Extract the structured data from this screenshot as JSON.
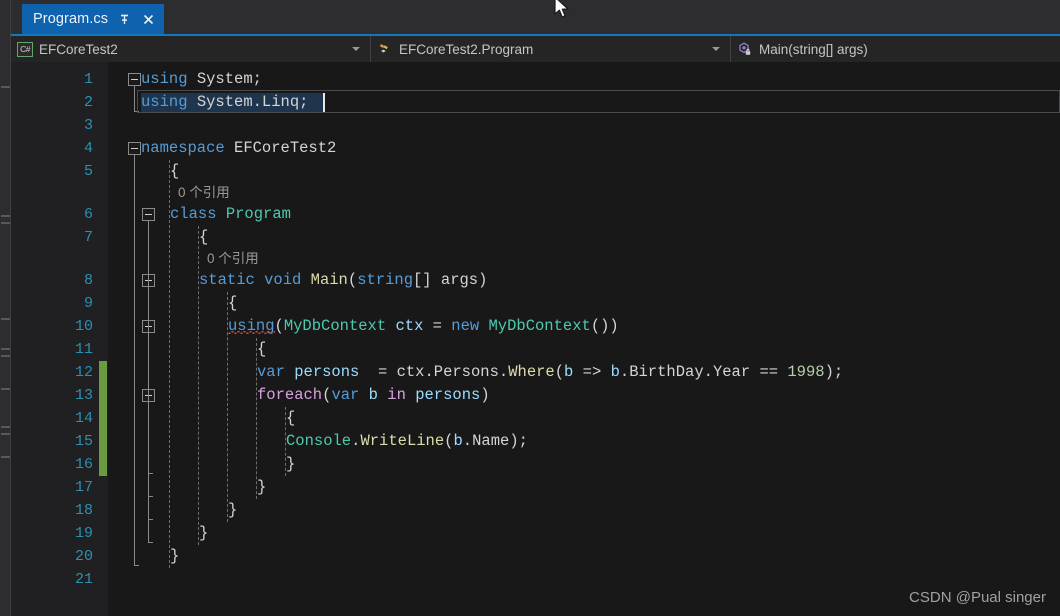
{
  "window": {
    "tab": {
      "title": "Program.cs",
      "pin_icon": "pin-icon",
      "close_icon": "close-icon"
    }
  },
  "nav_bar": {
    "project_combo": {
      "icon": "csharp-file-icon",
      "value": "EFCoreTest2",
      "dropdown_icon": "chevron-down-icon"
    },
    "type_combo": {
      "icon": "class-icon",
      "value": "EFCoreTest2.Program",
      "dropdown_icon": "chevron-down-icon"
    },
    "member_combo": {
      "icon": "method-private-icon",
      "value": "Main(string[] args)"
    }
  },
  "editor": {
    "line_numbers": [
      "1",
      "2",
      "3",
      "4",
      "5",
      "6",
      "7",
      "8",
      "9",
      "10",
      "11",
      "12",
      "13",
      "14",
      "15",
      "16",
      "17",
      "18",
      "19",
      "20",
      "21"
    ],
    "codelens": [
      {
        "text": "0 个引用",
        "for_line": "6"
      },
      {
        "text": "0 个引用",
        "for_line": "8"
      }
    ],
    "lines": [
      {
        "n": "1",
        "indent": 0,
        "tokens": [
          {
            "t": "using",
            "c": "k"
          },
          {
            "t": " System;",
            "c": "pn"
          }
        ]
      },
      {
        "n": "2",
        "indent": 0,
        "tokens": [
          {
            "t": "using",
            "c": "k"
          },
          {
            "t": " System.Linq;",
            "c": "pn"
          }
        ]
      },
      {
        "n": "3",
        "indent": 0,
        "tokens": []
      },
      {
        "n": "4",
        "indent": 0,
        "tokens": [
          {
            "t": "namespace",
            "c": "k"
          },
          {
            "t": " EFCoreTest2",
            "c": "id"
          }
        ]
      },
      {
        "n": "5",
        "indent": 1,
        "tokens": [
          {
            "t": "{",
            "c": "pn"
          }
        ]
      },
      {
        "n": "6",
        "indent": 1,
        "tokens": [
          {
            "t": "class",
            "c": "k"
          },
          {
            "t": " ",
            "c": "pn"
          },
          {
            "t": "Program",
            "c": "kc"
          }
        ]
      },
      {
        "n": "7",
        "indent": 2,
        "tokens": [
          {
            "t": "{",
            "c": "pn"
          }
        ]
      },
      {
        "n": "8",
        "indent": 2,
        "tokens": [
          {
            "t": "static",
            "c": "k"
          },
          {
            "t": " ",
            "c": "pn"
          },
          {
            "t": "void",
            "c": "k"
          },
          {
            "t": " ",
            "c": "pn"
          },
          {
            "t": "Main",
            "c": "mth"
          },
          {
            "t": "(",
            "c": "pn"
          },
          {
            "t": "string",
            "c": "k"
          },
          {
            "t": "[] ",
            "c": "pn"
          },
          {
            "t": "args",
            "c": "id"
          },
          {
            "t": ")",
            "c": "pn"
          }
        ]
      },
      {
        "n": "9",
        "indent": 3,
        "tokens": [
          {
            "t": "{",
            "c": "pn"
          }
        ]
      },
      {
        "n": "10",
        "indent": 3,
        "tokens": [
          {
            "t": "using",
            "c": "k"
          },
          {
            "t": "(",
            "c": "pn"
          },
          {
            "t": "MyDbContext",
            "c": "kc"
          },
          {
            "t": " ",
            "c": "pn"
          },
          {
            "t": "ctx",
            "c": "prm"
          },
          {
            "t": " = ",
            "c": "pn"
          },
          {
            "t": "new",
            "c": "k"
          },
          {
            "t": " ",
            "c": "pn"
          },
          {
            "t": "MyDbContext",
            "c": "kc"
          },
          {
            "t": "())",
            "c": "pn"
          }
        ]
      },
      {
        "n": "11",
        "indent": 4,
        "tokens": [
          {
            "t": "{",
            "c": "pn"
          }
        ]
      },
      {
        "n": "12",
        "indent": 4,
        "tokens": [
          {
            "t": "var",
            "c": "k"
          },
          {
            "t": " ",
            "c": "pn"
          },
          {
            "t": "persons",
            "c": "prm"
          },
          {
            "t": "  = ",
            "c": "pn"
          },
          {
            "t": "ctx",
            "c": "id"
          },
          {
            "t": ".",
            "c": "pn"
          },
          {
            "t": "Persons",
            "c": "id"
          },
          {
            "t": ".",
            "c": "pn"
          },
          {
            "t": "Where",
            "c": "mth"
          },
          {
            "t": "(",
            "c": "pn"
          },
          {
            "t": "b",
            "c": "prm"
          },
          {
            "t": " => ",
            "c": "pn"
          },
          {
            "t": "b",
            "c": "prm"
          },
          {
            "t": ".",
            "c": "pn"
          },
          {
            "t": "BirthDay",
            "c": "id"
          },
          {
            "t": ".",
            "c": "pn"
          },
          {
            "t": "Year",
            "c": "id"
          },
          {
            "t": " == ",
            "c": "pn"
          },
          {
            "t": "1998",
            "c": "num"
          },
          {
            "t": ");",
            "c": "pn"
          }
        ]
      },
      {
        "n": "13",
        "indent": 4,
        "tokens": [
          {
            "t": "foreach",
            "c": "ctl"
          },
          {
            "t": "(",
            "c": "pn"
          },
          {
            "t": "var",
            "c": "k"
          },
          {
            "t": " ",
            "c": "pn"
          },
          {
            "t": "b",
            "c": "prm"
          },
          {
            "t": " ",
            "c": "pn"
          },
          {
            "t": "in",
            "c": "ctl"
          },
          {
            "t": " ",
            "c": "pn"
          },
          {
            "t": "persons",
            "c": "prm"
          },
          {
            "t": ")",
            "c": "pn"
          }
        ]
      },
      {
        "n": "14",
        "indent": 5,
        "tokens": [
          {
            "t": "{",
            "c": "pn"
          }
        ]
      },
      {
        "n": "15",
        "indent": 5,
        "tokens": [
          {
            "t": "Console",
            "c": "kc"
          },
          {
            "t": ".",
            "c": "pn"
          },
          {
            "t": "WriteLine",
            "c": "mth"
          },
          {
            "t": "(",
            "c": "pn"
          },
          {
            "t": "b",
            "c": "prm"
          },
          {
            "t": ".",
            "c": "pn"
          },
          {
            "t": "Name",
            "c": "id"
          },
          {
            "t": ");",
            "c": "pn"
          }
        ]
      },
      {
        "n": "16",
        "indent": 5,
        "tokens": [
          {
            "t": "}",
            "c": "pn"
          }
        ]
      },
      {
        "n": "17",
        "indent": 4,
        "tokens": [
          {
            "t": "}",
            "c": "pn"
          }
        ]
      },
      {
        "n": "18",
        "indent": 3,
        "tokens": [
          {
            "t": "}",
            "c": "pn"
          }
        ]
      },
      {
        "n": "19",
        "indent": 2,
        "tokens": [
          {
            "t": "}",
            "c": "pn"
          }
        ]
      },
      {
        "n": "20",
        "indent": 1,
        "tokens": [
          {
            "t": "}",
            "c": "pn"
          }
        ]
      },
      {
        "n": "21",
        "indent": 0,
        "tokens": []
      }
    ],
    "change_bar": {
      "from_line": "12",
      "to_line": "16",
      "color": "#6a9b43"
    },
    "current_line": "2"
  },
  "watermark": {
    "text": "CSDN @Pual singer"
  },
  "colors": {
    "accent_tab": "#0f62ad",
    "nav_top_border": "#1277bc",
    "line_number": "#2b91af",
    "keyword": "#569cd6",
    "type": "#4ec9b0",
    "method": "#dcdcaa",
    "control": "#d8a0df",
    "number": "#b5cea8",
    "parameter": "#9cdcfe",
    "editor_bg": "#181819",
    "gutter_bg": "#202022"
  }
}
